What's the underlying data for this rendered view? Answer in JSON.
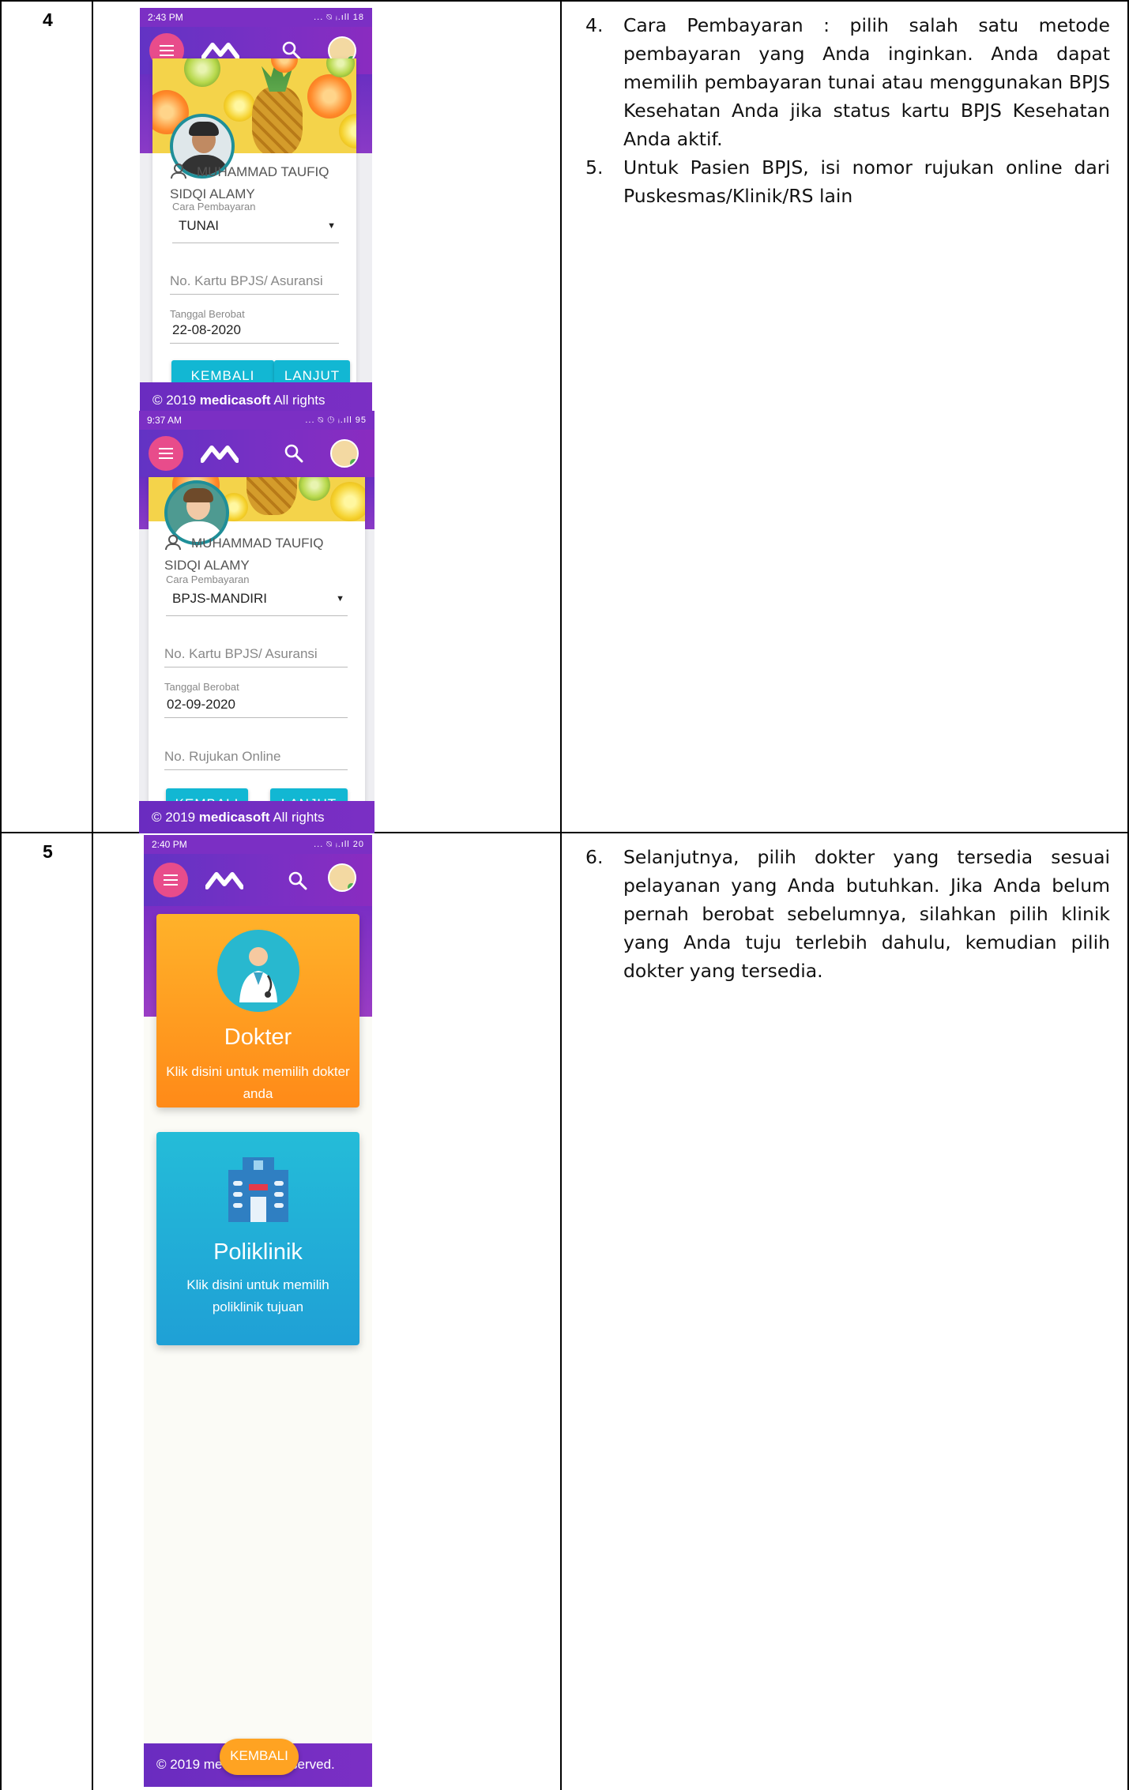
{
  "rows": [
    {
      "number": "4",
      "steps": [
        {
          "n": "4.",
          "text": "Cara Pembayaran : pilih salah satu metode pembayaran yang Anda inginkan. Anda dapat memilih pembayaran tunai atau menggunakan BPJS Kesehatan Anda jika status kartu BPJS Kesehatan Anda aktif."
        },
        {
          "n": "5.",
          "text": "Untuk Pasien BPJS, isi nomor rujukan online dari Puskesmas/Klinik/RS lain"
        }
      ]
    },
    {
      "number": "5",
      "steps": [
        {
          "n": "6.",
          "text": "Selanjutnya, pilih dokter yang tersedia sesuai pelayanan yang Anda butuhkan. Jika Anda belum pernah berobat sebelumnya, silahkan pilih klinik yang Anda tuju terlebih dahulu, kemudian pilih dokter yang tersedia."
        }
      ]
    }
  ],
  "screen1": {
    "time": "2:43 PM",
    "status_icons": "... ⍉ ᵢ.ıll 18",
    "user_name": "MUHAMMAD TAUFIQ SIDQI ALAMY",
    "payment_label": "Cara Pembayaran",
    "payment_value": "TUNAI",
    "bpjs_placeholder": "No. Kartu BPJS/ Asuransi",
    "date_label": "Tanggal Berobat",
    "date_value": "22-08-2020",
    "back": "KEMBALI",
    "next": "LANJUT",
    "footer_pre": "© 2019 ",
    "footer_brand": "medicasoft",
    "footer_post": " All rights reserved."
  },
  "screen2": {
    "time": "9:37 AM",
    "status_icons": "... ⍉ ◷ ᵢ.ıll 95",
    "user_name": "MUHAMMAD TAUFIQ SIDQI ALAMY",
    "payment_label": "Cara Pembayaran",
    "payment_value": "BPJS-MANDIRI",
    "bpjs_placeholder": "No. Kartu BPJS/ Asuransi",
    "date_label": "Tanggal Berobat",
    "date_value": "02-09-2020",
    "referral_placeholder": "No. Rujukan Online",
    "back": "KEMBALI",
    "next": "LANJUT",
    "footer_pre": "© 2019 ",
    "footer_brand": "medicasoft",
    "footer_post": " All rights reserved."
  },
  "screen3": {
    "time": "2:40 PM",
    "status_icons": "... ⍉ ᵢ.ıll 20",
    "doctor_title": "Dokter",
    "doctor_sub": "Klik disini untuk memilih dokter anda",
    "clinic_title": "Poliklinik",
    "clinic_sub": "Klik disini untuk memilih poliklinik tujuan",
    "footer_left": "© 2019 medic",
    "footer_right": "served.",
    "back": "KEMBALI"
  },
  "colors": {
    "purple": "#7b2fc4",
    "pink": "#e84c8b",
    "teal_button": "#12b7d3",
    "orange_card": "#ff9a1f",
    "blue_card": "#1fa6d8",
    "pill": "#ffa322"
  },
  "icons": [
    "menu-icon",
    "logo-icon",
    "search-icon",
    "user-icon",
    "doctor-icon",
    "hospital-icon"
  ]
}
